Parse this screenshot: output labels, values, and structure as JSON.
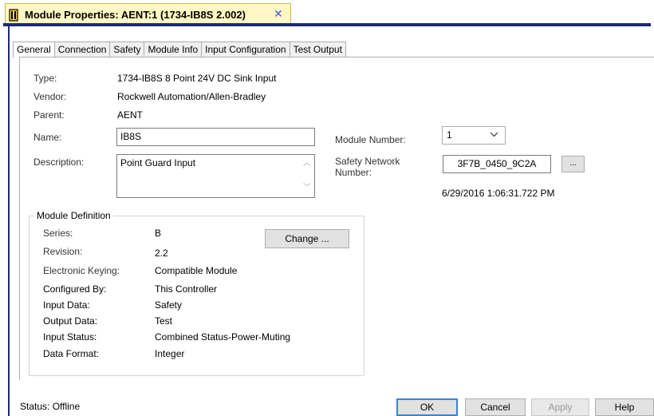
{
  "window": {
    "title": "Module Properties: AENT:1 (1734-IB8S 2.002)",
    "close_glyph": "✕"
  },
  "tabs": [
    {
      "label": "General",
      "active": true
    },
    {
      "label": "Connection"
    },
    {
      "label": "Safety"
    },
    {
      "label": "Module Info"
    },
    {
      "label": "Input Configuration"
    },
    {
      "label": "Test Output"
    }
  ],
  "general": {
    "type_label": "Type:",
    "type_value": "1734-IB8S 8 Point 24V DC Sink Input",
    "vendor_label": "Vendor:",
    "vendor_value": "Rockwell Automation/Allen-Bradley",
    "parent_label": "Parent:",
    "parent_value": "AENT",
    "name_label": "Name:",
    "name_value": "IB8S",
    "description_label": "Description:",
    "description_value": "Point Guard Input",
    "module_number_label": "Module Number:",
    "module_number_value": "1",
    "safety_network_label_line1": "Safety Network",
    "safety_network_label_line2": "Number:",
    "safety_network_value": "3F7B_0450_9C2A",
    "safety_network_browse": "...",
    "timestamp": "6/29/2016 1:06:31.722 PM"
  },
  "module_definition": {
    "legend": "Module Definition",
    "change_button": "Change ...",
    "rows": [
      {
        "label": "Series:",
        "value": "B"
      },
      {
        "label": "Revision:",
        "value": "2.2"
      },
      {
        "label": "Electronic Keying:",
        "value": "Compatible Module"
      },
      {
        "label": "Configured By:",
        "value": "This Controller"
      },
      {
        "label": "Input Data:",
        "value": "Safety"
      },
      {
        "label": "Output Data:",
        "value": "Test"
      },
      {
        "label": "Input Status:",
        "value": "Combined Status-Power-Muting"
      },
      {
        "label": "Data Format:",
        "value": "Integer"
      }
    ]
  },
  "footer": {
    "status": "Status:  Offline",
    "ok": "OK",
    "cancel": "Cancel",
    "apply": "Apply",
    "help": "Help"
  },
  "icons": {
    "window_icon": "module-icon",
    "close": "close-icon",
    "combo": "chevron-down-icon",
    "scroll_up": "scroll-up-icon",
    "scroll_down": "scroll-down-icon"
  },
  "colors": {
    "tab_highlight": "#fff8c4",
    "frame_accent": "#1a2b7a",
    "default_button_border": "#3b82d6"
  }
}
